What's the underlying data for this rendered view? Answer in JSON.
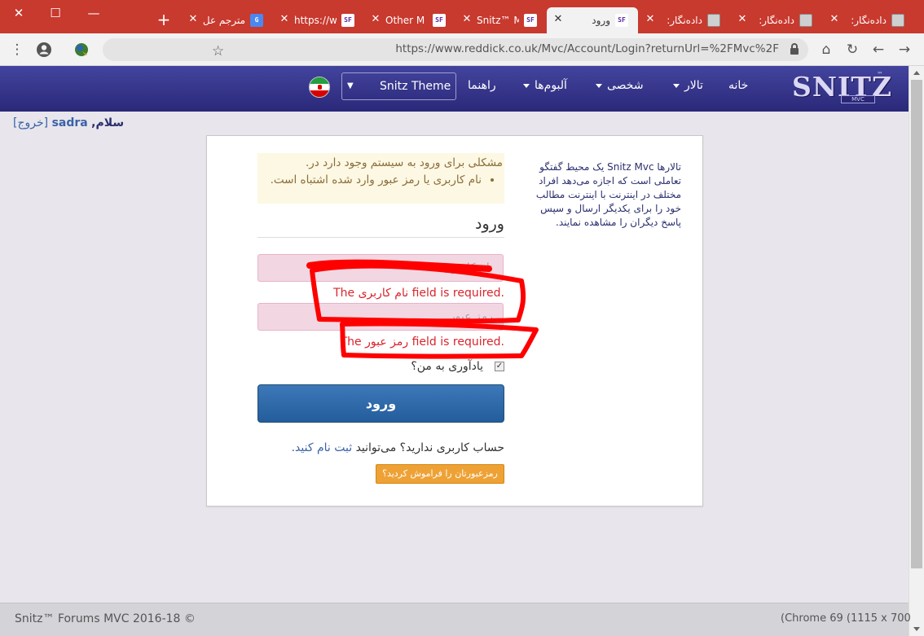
{
  "browser": {
    "window_controls": {
      "close": "✕",
      "maximize": "☐",
      "minimize": "—"
    },
    "new_tab": "+",
    "tabs": [
      {
        "title": "مترجم عل",
        "favicon": "G",
        "active": false
      },
      {
        "title": "https://w",
        "favicon": "SF",
        "active": false
      },
      {
        "title": "Other M",
        "favicon": "SF",
        "active": false
      },
      {
        "title": "Snitz™ M",
        "favicon": "SF",
        "active": false
      },
      {
        "title": "ورود",
        "favicon": "SF",
        "active": true
      },
      {
        "title": "دادەنگار:",
        "favicon": "pic",
        "active": false
      },
      {
        "title": "دادەنگار:",
        "favicon": "pic",
        "active": false
      },
      {
        "title": "دادەنگار:",
        "favicon": "pic",
        "active": false
      }
    ],
    "url": "https://www.reddick.co.uk/Mvc/Account/Login?returnUrl=%2FMvc%2F",
    "icons": {
      "menu": "⋮",
      "profile": "●",
      "star": "☆",
      "home": "⌂",
      "reload": "↻",
      "back": "←",
      "forward": "→"
    }
  },
  "site": {
    "logo": {
      "text": "SNITZ",
      "sub": "MVC",
      "tm": "™"
    },
    "nav": {
      "home": "خانه",
      "forums": "تالار",
      "personal": "شخصی",
      "albums": "آلبوم‌ها",
      "help": "راهنما"
    },
    "theme_select": {
      "value": "Snitz Theme",
      "arrow": "▼"
    },
    "greeting": {
      "hello": "سلام,",
      "user": "sadra",
      "logout": "[خروج]"
    }
  },
  "login": {
    "about": "تالارها Snitz Mvc یک محیط گفتگو تعاملی است که اجازه می‌دهد افراد مختلف در اینترنت با اینترنت مطالب خود را برای یکدیگر ارسال و سپس پاسخ دیگران را مشاهده نمایند.",
    "error_summary": "مشکلی برای ورود به سیستم وجود دارد در.",
    "error_item": "نام کاربری یا رمز عبور وارد شده اشتباه است.",
    "title": "ورود",
    "username_placeholder": "نام کاربری",
    "username_error": "The نام کاربری field is required.",
    "password_placeholder": "رمز عبور",
    "password_error": "The رمز عبور field is required.",
    "remember_me": "یادآوری به من؟",
    "remember_checked": true,
    "submit": "ورود",
    "register_text": "حساب کاربری ندارید؟ می‌توانید",
    "register_link": "ثبت نام کنید.",
    "forgot": "رمزعبورتان را فراموش کردید؟"
  },
  "footer": {
    "copyright": "Snitz™ Forums MVC 2016-18 ©",
    "system": "(Chrome 69 (1115 x 700"
  },
  "colors": {
    "tabstrip": "#c8392e",
    "navbar": "#2f2e84",
    "button": "#2e6aac",
    "warning": "#eea236",
    "error_text": "#d9242c",
    "annotation": "#ff0000"
  }
}
